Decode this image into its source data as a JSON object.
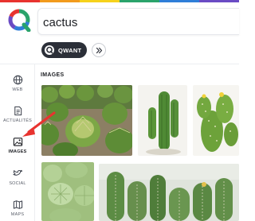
{
  "search": {
    "query": "cactus"
  },
  "chips": {
    "engine_label": "QWANT"
  },
  "sidebar": {
    "items": [
      {
        "label": "WEB",
        "icon": "globe-icon"
      },
      {
        "label": "ACTUALITÉS",
        "icon": "newspaper-icon"
      },
      {
        "label": "IMAGES",
        "icon": "image-icon",
        "active": true
      },
      {
        "label": "SOCIAL",
        "icon": "bird-icon"
      },
      {
        "label": "MAPS",
        "icon": "map-icon"
      }
    ]
  },
  "results": {
    "section_title": "IMAGES"
  },
  "colors": {
    "accent_red": "#e8332f",
    "chip_dark": "#2b2f38",
    "brand_blue": "#2f7ed8",
    "brand_green": "#2aa36b"
  }
}
